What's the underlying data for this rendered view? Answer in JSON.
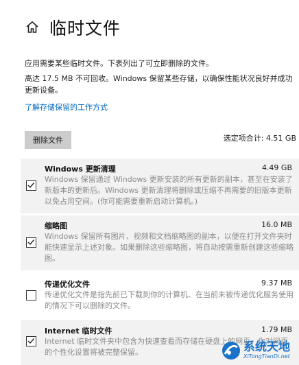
{
  "header": {
    "title": "临时文件",
    "home_icon": "home-icon"
  },
  "description": {
    "line1": "应用需要某些临时文件。下表列出了可立即删除的文件。",
    "line2": "高达 17.5 MB 不可回收。Windows 保留某些存储，以确保性能状况良好并成功更新设备。",
    "learn_more": "了解存储保留的工作方式"
  },
  "toolbar": {
    "delete_label": "删除文件",
    "selected_total": "选定项合计: 4.51 GB"
  },
  "items": [
    {
      "title": "Windows 更新清理",
      "size": "4.49 GB",
      "checked": true,
      "desc": "Windows 保留通过 Windows 更新安装的所有更新的副本，甚至在安装了新版本的更新后。Windows 更新清理将删除或压缩不再需要的旧版本更新以免占用空间。(你可能需要重新启动计算机。)"
    },
    {
      "title": "缩略图",
      "size": "16.0 MB",
      "checked": true,
      "desc": "Windows 保留所有图片、视频和文档缩略图的副本，以便在打开文件夹时能快速显示上述对象。如果删除这些缩略图，将自动按需重新创建这些缩略图。"
    },
    {
      "title": "传递优化文件",
      "size": "9.37 MB",
      "checked": false,
      "desc": "传递优化文件是指先前已下载到你的计算机、在当前未被传递优化服务使用的情况下可以删除的文件。"
    },
    {
      "title": "Internet 临时文件",
      "size": "1.79 MB",
      "checked": true,
      "desc": "Internet 临时文件夹中包含为快速查看而存储在硬盘上的网页。你对网页的个性化设置将被完整保留。"
    }
  ],
  "watermark": {
    "main": "系统天地",
    "sub": "XiTongTianDi.net"
  },
  "colors": {
    "link": "#0067c0",
    "button_bg": "#cccccc",
    "item_bg": "#f2f2f2",
    "watermark": "#1a73c8"
  }
}
